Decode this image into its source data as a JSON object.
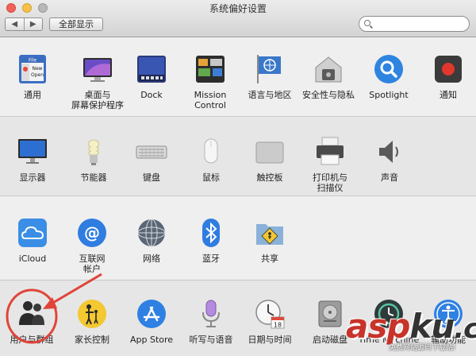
{
  "window": {
    "title": "系统偏好设置",
    "show_all_label": "全部显示",
    "back_glyph": "◀",
    "forward_glyph": "▶",
    "search": {
      "placeholder": "",
      "value": ""
    }
  },
  "sections": [
    {
      "items": [
        {
          "label": "通用",
          "icon": "general-icon"
        },
        {
          "label": "桌面与\n屏幕保护程序",
          "icon": "desktop-screensaver-icon"
        },
        {
          "label": "Dock",
          "icon": "dock-icon"
        },
        {
          "label": "Mission\nControl",
          "icon": "mission-control-icon"
        },
        {
          "label": "语言与地区",
          "icon": "language-region-icon"
        },
        {
          "label": "安全性与隐私",
          "icon": "security-privacy-icon"
        },
        {
          "label": "Spotlight",
          "icon": "spotlight-icon"
        },
        {
          "label": "通知",
          "icon": "notifications-icon"
        }
      ]
    },
    {
      "items": [
        {
          "label": "显示器",
          "icon": "displays-icon"
        },
        {
          "label": "节能器",
          "icon": "energy-saver-icon"
        },
        {
          "label": "键盘",
          "icon": "keyboard-icon"
        },
        {
          "label": "鼠标",
          "icon": "mouse-icon"
        },
        {
          "label": "触控板",
          "icon": "trackpad-icon"
        },
        {
          "label": "打印机与\n扫描仪",
          "icon": "printer-scanner-icon"
        },
        {
          "label": "声音",
          "icon": "sound-icon"
        }
      ]
    },
    {
      "items": [
        {
          "label": "iCloud",
          "icon": "icloud-icon"
        },
        {
          "label": "互联网\n帐户",
          "icon": "internet-accounts-icon"
        },
        {
          "label": "网络",
          "icon": "network-icon"
        },
        {
          "label": "蓝牙",
          "icon": "bluetooth-icon"
        },
        {
          "label": "共享",
          "icon": "sharing-icon"
        }
      ]
    },
    {
      "items": [
        {
          "label": "用户与群组",
          "icon": "users-groups-icon"
        },
        {
          "label": "家长控制",
          "icon": "parental-controls-icon"
        },
        {
          "label": "App Store",
          "icon": "app-store-icon"
        },
        {
          "label": "听写与语音",
          "icon": "dictation-speech-icon"
        },
        {
          "label": "日期与时间",
          "icon": "date-time-icon"
        },
        {
          "label": "启动磁盘",
          "icon": "startup-disk-icon"
        },
        {
          "label": "Time Machine",
          "icon": "time-machine-icon"
        },
        {
          "label": "辅助功能",
          "icon": "accessibility-icon"
        }
      ]
    }
  ],
  "icon_text": {
    "general_file": "File",
    "general_new": "New",
    "general_open": "Open",
    "calendar_day": "18"
  },
  "watermark": {
    "brand": "asp",
    "brand2": "ku",
    "tld": ".com",
    "subtitle": "免费网站源码下载站!"
  },
  "colors": {
    "annotation_red": "#e0453a"
  }
}
